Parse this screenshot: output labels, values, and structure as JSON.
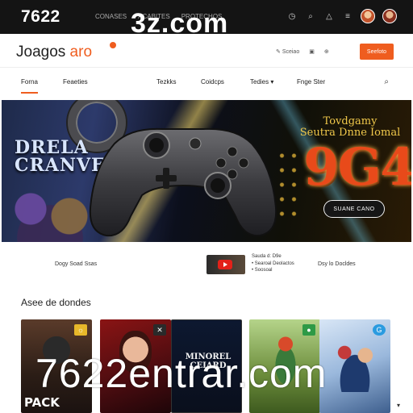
{
  "topbar": {
    "logo": "7622",
    "links": [
      "CONASES",
      "ACABITES",
      "PROTECHOS"
    ],
    "overlay_text": "3z.com"
  },
  "header": {
    "brand_main": "Joagos ",
    "brand_accent": "aro",
    "links": [
      "Sceiao",
      "",
      ""
    ],
    "cta": "Seefoto"
  },
  "nav": {
    "items": [
      "Forna",
      "Feaeties",
      "Tezkks",
      "Coidcps",
      "Tedies ▾",
      "Fnge Ster"
    ]
  },
  "hero": {
    "left_title_1": "DRELA",
    "left_title_2": "CRANVE",
    "right_title_1": "Tovdgamy",
    "right_title_2": "Seutra Dnne Iomal",
    "big_text": "9G4",
    "button": "SUANE CANO"
  },
  "strip": {
    "left_text": "Dogy Soad Ssas",
    "list": [
      "Sauda d: D9e",
      "• Searoal  Deolactos",
      "• Soosoal"
    ],
    "right_text": "Dsy lo Docldes"
  },
  "section": {
    "title": "Asee de dondes"
  },
  "cards": [
    {
      "label": "PACK",
      "badge": "☼",
      "badge_color": "#e8b82a"
    },
    {
      "label": "",
      "badge": "✕",
      "badge_color": "#2a2a2a"
    },
    {
      "label": "MINOREL CEIARD",
      "badge": "",
      "badge_color": ""
    },
    {
      "label": "",
      "badge": "●",
      "badge_color": "#2e9a46"
    },
    {
      "label": "",
      "badge": "G",
      "badge_color": "#2a9be0"
    }
  ],
  "bottom_overlay": "7622entrar.com",
  "colors": {
    "accent": "#ef5d1f",
    "topbar": "#141414"
  }
}
